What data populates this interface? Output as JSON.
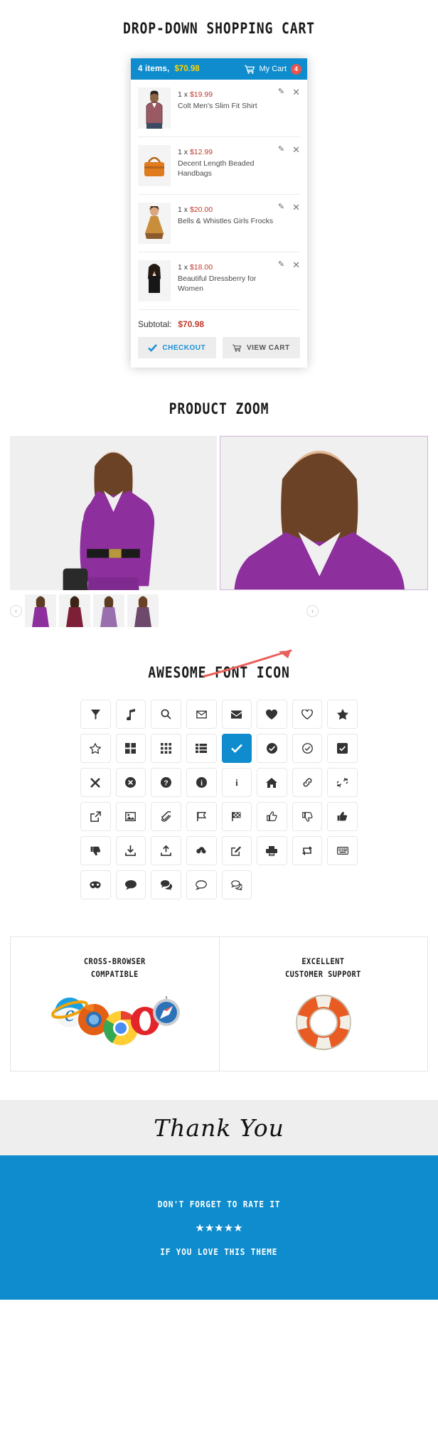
{
  "sections": {
    "cart": {
      "title": "DROP-DOWN SHOPPING CART"
    },
    "zoom": {
      "title": "PRODUCT ZOOM"
    },
    "icons": {
      "title": "AWESOME FONT ICON"
    }
  },
  "cart": {
    "header": {
      "items_label": "4 items,",
      "total": "$70.98",
      "cart_label": "My Cart",
      "badge": "4",
      "bg_color": "#0e8ccd",
      "total_color": "#ffd400",
      "badge_color": "#e8554e"
    },
    "items": [
      {
        "qty_price": "1 x ",
        "price": "$19.99",
        "name": "Colt Men's Slim Fit Shirt",
        "edit_icon": "pencil-icon",
        "remove_icon": "close-icon"
      },
      {
        "qty_price": "1 x ",
        "price": "$12.99",
        "name": "Decent Length Beaded Handbags",
        "edit_icon": "pencil-icon",
        "remove_icon": "close-icon"
      },
      {
        "qty_price": "1 x ",
        "price": "$20.00",
        "name": "Bells & Whistles Girls Frocks",
        "edit_icon": "pencil-icon",
        "remove_icon": "close-icon"
      },
      {
        "qty_price": "1 x ",
        "price": "$18.00",
        "name": "Beautiful Dressberry for Women",
        "edit_icon": "pencil-icon",
        "remove_icon": "close-icon"
      }
    ],
    "subtotal_label": "Subtotal:",
    "subtotal_value": "$70.98",
    "buttons": {
      "checkout": "CHECKOUT",
      "view_cart": "VIEW CART"
    }
  },
  "product_zoom": {
    "prev_arrow": "‹",
    "next_arrow": "›",
    "thumb_count": 4
  },
  "icon_grid": {
    "rows": [
      [
        "filter-funnel-icon",
        "music-note-icon",
        "search-icon",
        "envelope-outline-icon",
        "envelope-filled-icon",
        "heart-filled-icon",
        "heart-outline-icon",
        "star-filled-icon",
        "star-outline-icon"
      ],
      [
        "grid-large-icon",
        "grid-small-icon",
        "list-icon",
        "check-icon",
        "check-circle-filled-icon",
        "check-circle-outline-icon",
        "check-square-icon",
        "times-icon",
        "times-circle-icon"
      ],
      [
        "question-circle-icon",
        "info-circle-filled-icon",
        "info-icon",
        "home-icon",
        "link-icon",
        "chain-broken-icon",
        "external-link-icon",
        "image-icon",
        "paperclip-icon"
      ],
      [
        "flag-outline-icon",
        "flag-checkered-icon",
        "thumbs-up-outline-icon",
        "thumbs-down-outline-icon",
        "thumbs-up-filled-icon",
        "thumbs-down-filled-icon",
        "download-icon",
        "upload-icon",
        "cloud-download-icon"
      ],
      [
        "edit-square-icon",
        "print-icon",
        "retweet-icon",
        "keyboard-icon",
        "mask-icon",
        "comment-filled-icon",
        "comments-filled-icon",
        "comment-outline-icon",
        "comments-outline-icon"
      ]
    ],
    "active_index": {
      "row": 1,
      "col": 3
    },
    "active_color": "#0e8ccd"
  },
  "features": [
    {
      "title_line1": "CROSS-BROWSER",
      "title_line2": "COMPATIBLE",
      "art": "browser-logos"
    },
    {
      "title_line1": "EXCELLENT",
      "title_line2": "CUSTOMER SUPPORT",
      "art": "lifebuoy"
    }
  ],
  "thank_you": {
    "text": "Thank You",
    "bg_color": "#eeeeee"
  },
  "footer": {
    "line1": "DON'T FORGET TO RATE IT",
    "stars": "★★★★★",
    "line2": "IF YOU LOVE THIS THEME",
    "bg_color": "#0e8ccd"
  }
}
